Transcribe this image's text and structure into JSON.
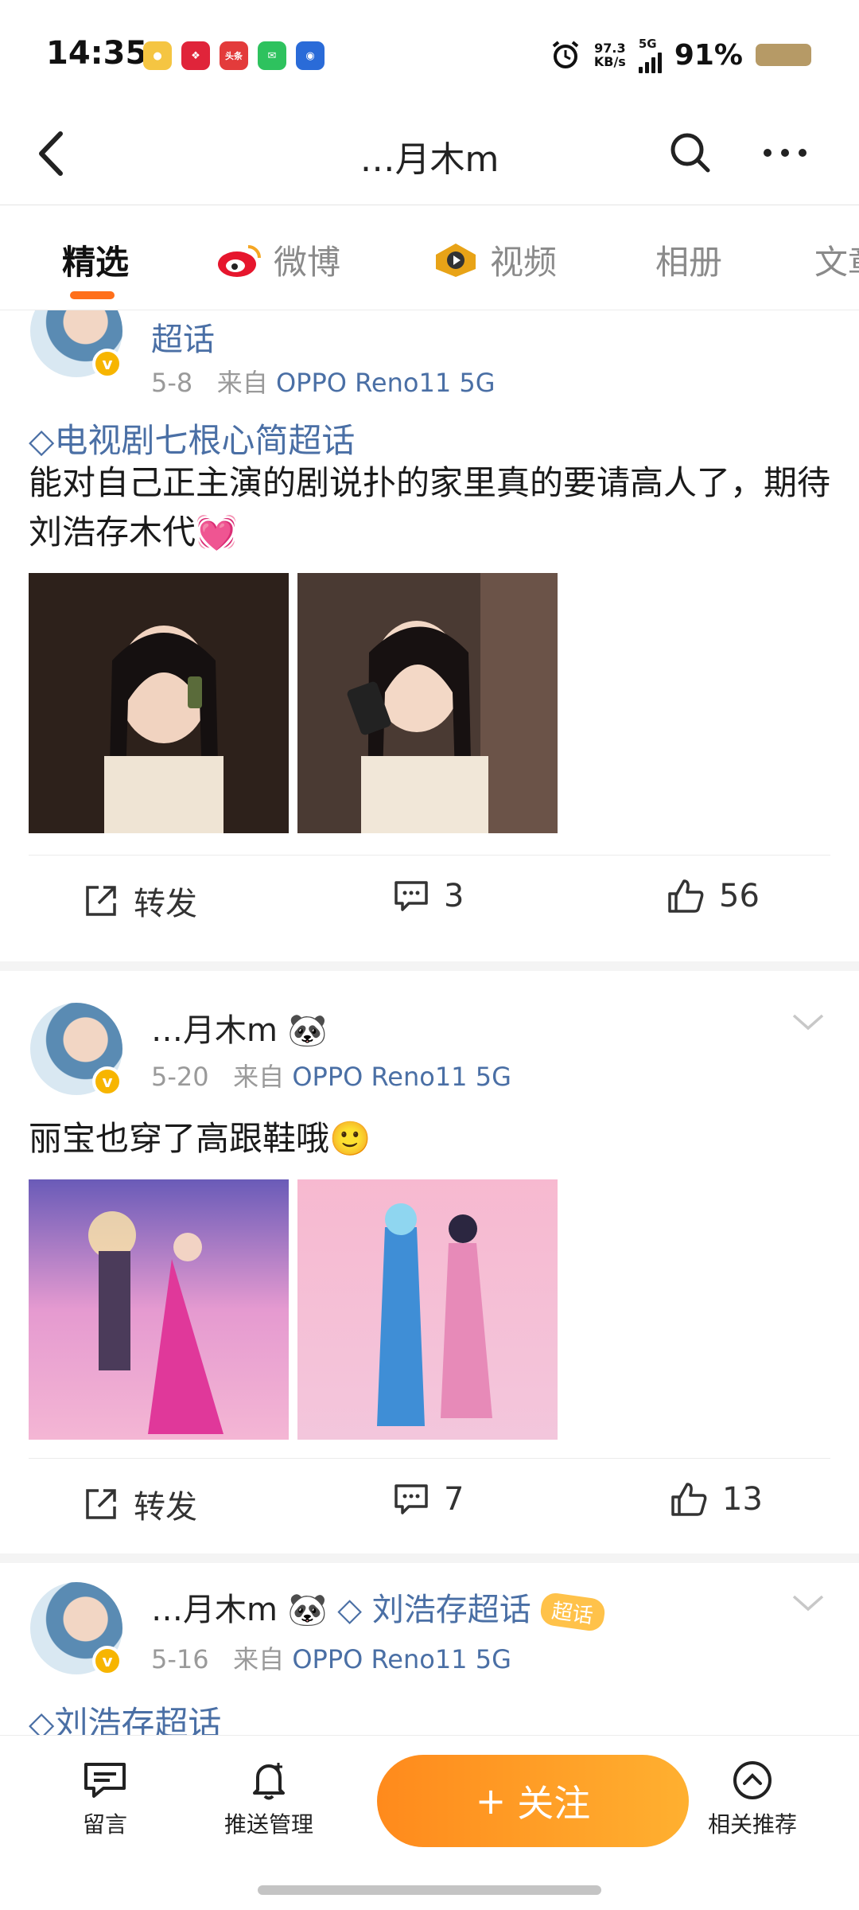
{
  "status_bar": {
    "time": "14:35",
    "network_speed_value": "97.3",
    "network_speed_unit": "KB/s",
    "network_type": "5G",
    "battery": "91%",
    "notification_icons": [
      "weibo-icon",
      "app-red-icon",
      "toutiao-icon",
      "wechat-icon",
      "blue-app-icon"
    ],
    "toutiao_label": "头条"
  },
  "header": {
    "title": "…月木m"
  },
  "tabs": [
    {
      "label": "精选",
      "active": true
    },
    {
      "label": "微博",
      "active": false
    },
    {
      "label": "视频",
      "active": false
    },
    {
      "label": "相册",
      "active": false
    },
    {
      "label": "文章",
      "active": false
    }
  ],
  "posts": [
    {
      "username_tail": "超话",
      "date": "5-8",
      "source_prefix": "来自",
      "device": "OPPO Reno11 5G",
      "topic": "电视剧七根心简超话",
      "text": "能对自己正主演的剧说扑的家里真的要请高人了，期待刘浩存木代",
      "emoji": "💓",
      "images": [
        "photo-woman-phone-1",
        "photo-woman-phone-2"
      ],
      "repost_label": "转发",
      "comments": "3",
      "likes": "56"
    },
    {
      "username": "…月木m",
      "username_emoji": "🐼",
      "date": "5-20",
      "source_prefix": "来自",
      "device": "OPPO Reno11 5G",
      "text": "丽宝也穿了高跟鞋哦",
      "emoji": "🙂",
      "images": [
        "animation-dance-1",
        "animation-dance-2"
      ],
      "repost_label": "转发",
      "comments": "7",
      "likes": "13"
    },
    {
      "username": "…月木m",
      "username_emoji": "🐼",
      "topic_inline": "刘浩存超话",
      "super_topic_badge": "超话",
      "date": "5-16",
      "source_prefix": "来自",
      "device": "OPPO Reno11 5G",
      "topic": "刘浩存超话"
    }
  ],
  "bottom_bar": {
    "message": "留言",
    "push_manage": "推送管理",
    "follow": "关注",
    "related": "相关推荐"
  },
  "colors": {
    "accent": "#ff8a1c",
    "link": "#4a6fa5",
    "verified": "#f7b500"
  }
}
